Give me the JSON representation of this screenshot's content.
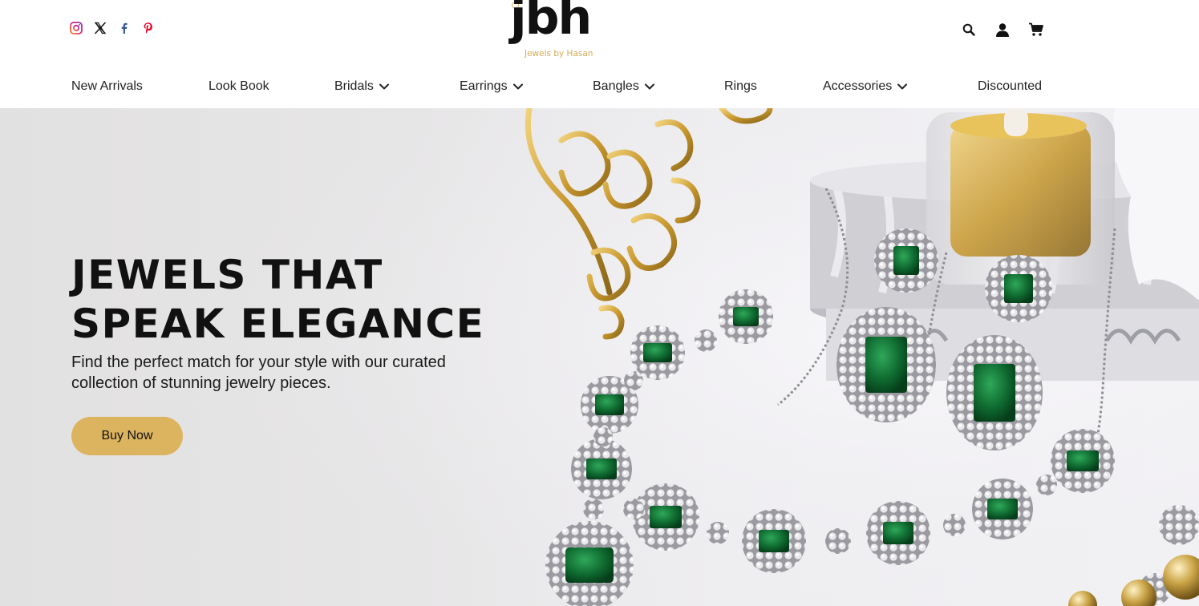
{
  "brand": {
    "logo_text": "jbh",
    "logo_subtitle": "Jewels by Hasan",
    "accent_color": "#dcb35f"
  },
  "header": {
    "social_icons": [
      "instagram-icon",
      "x-twitter-icon",
      "facebook-icon",
      "pinterest-icon"
    ],
    "action_icons": [
      "search-icon",
      "account-icon",
      "cart-icon"
    ]
  },
  "nav": {
    "items": [
      {
        "label": "New Arrivals",
        "has_dropdown": false
      },
      {
        "label": "Look Book",
        "has_dropdown": false
      },
      {
        "label": "Bridals",
        "has_dropdown": true
      },
      {
        "label": "Earrings",
        "has_dropdown": true
      },
      {
        "label": "Bangles",
        "has_dropdown": true
      },
      {
        "label": "Rings",
        "has_dropdown": false
      },
      {
        "label": "Accessories",
        "has_dropdown": true
      },
      {
        "label": "Discounted",
        "has_dropdown": false
      }
    ]
  },
  "hero": {
    "title_line1": "JEWELS THAT",
    "title_line2": "SPEAK ELEGANCE",
    "description": "Find the perfect match for your style with our curated collection of stunning jewelry pieces.",
    "cta_label": "Buy Now"
  }
}
